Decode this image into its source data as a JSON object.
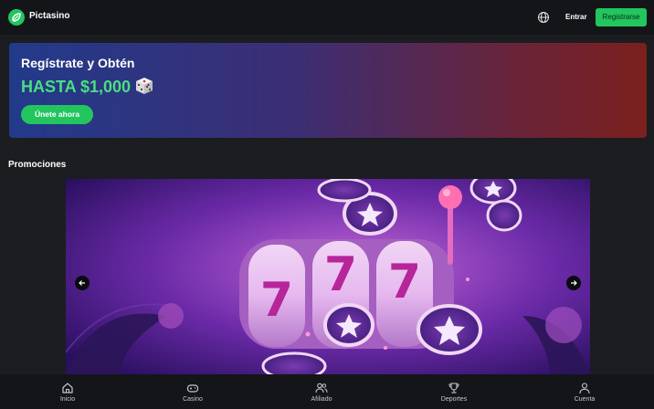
{
  "header": {
    "brand": "Pictasino",
    "login_label": "Entrar",
    "register_label": "Registrarse"
  },
  "hero": {
    "title": "Regístrate y Obtén",
    "amount": "HASTA $1,000",
    "cta_label": "Únete ahora"
  },
  "promotions": {
    "title": "Promociones",
    "banner_reel_digits": [
      "7",
      "7",
      "7"
    ]
  },
  "bottom_nav": {
    "items": [
      {
        "label": "Inicio",
        "icon": "home-icon"
      },
      {
        "label": "Casino",
        "icon": "gamepad-icon"
      },
      {
        "label": "Afiliado",
        "icon": "users-icon"
      },
      {
        "label": "Deportes",
        "icon": "trophy-icon"
      },
      {
        "label": "Cuenta",
        "icon": "user-icon"
      }
    ]
  },
  "colors": {
    "accent": "#22c55e",
    "amount": "#4ade80",
    "background": "#1c1d21",
    "bar": "#141519"
  }
}
